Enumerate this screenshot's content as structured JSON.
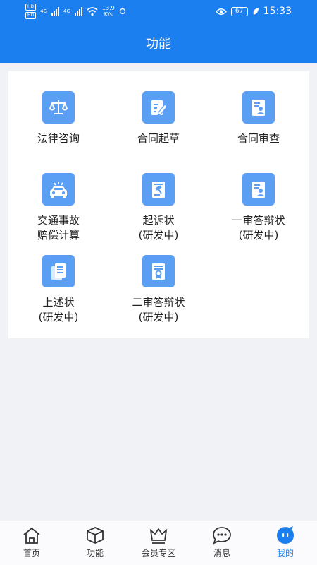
{
  "status_bar": {
    "hd1": "HD",
    "hd2": "HD",
    "sig1": "4G",
    "sig2": "4G",
    "speed_value": "13.9",
    "speed_unit": "K/s",
    "battery": "67",
    "time": "15:33"
  },
  "header": {
    "title": "功能"
  },
  "functions": [
    {
      "line1": "法律咨询",
      "line2": "",
      "icon": "scales-icon"
    },
    {
      "line1": "合同起草",
      "line2": "",
      "icon": "edit-document-icon"
    },
    {
      "line1": "合同审查",
      "line2": "",
      "icon": "document-person-icon"
    },
    {
      "line1": "交通事故",
      "line2": "赔偿计算",
      "icon": "car-accident-icon"
    },
    {
      "line1": "起诉状",
      "line2": "(研发中)",
      "icon": "gavel-book-icon"
    },
    {
      "line1": "一审答辩状",
      "line2": "(研发中)",
      "icon": "document-person-icon"
    },
    {
      "line1": "上述状",
      "line2": "(研发中)",
      "icon": "documents-stack-icon"
    },
    {
      "line1": "二审答辩状",
      "line2": "(研发中)",
      "icon": "certificate-icon"
    }
  ],
  "tabs": [
    {
      "label": "首页",
      "icon": "home-icon"
    },
    {
      "label": "功能",
      "icon": "cube-icon"
    },
    {
      "label": "会员专区",
      "icon": "crown-icon"
    },
    {
      "label": "消息",
      "icon": "chat-icon"
    },
    {
      "label": "我的",
      "icon": "profile-icon"
    }
  ],
  "colors": {
    "primary": "#1c7ff0",
    "icon_bg": "#5b9ff5",
    "background": "#f1f2f6"
  }
}
